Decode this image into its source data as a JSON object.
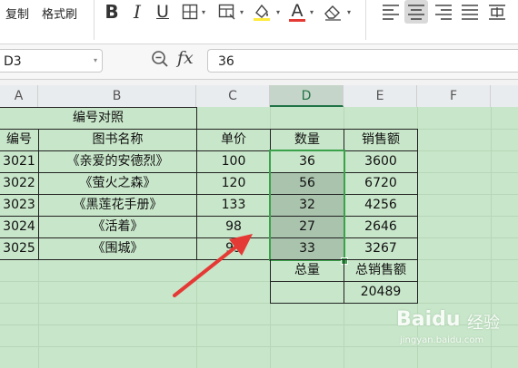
{
  "ribbon": {
    "copy_label": "复制",
    "format_painter_label": "格式刷",
    "bold_label": "B",
    "italic_label": "I",
    "underline_label": "U",
    "font_color_label": "A"
  },
  "formula_bar": {
    "name_box_value": "D3",
    "fx_label": "fx",
    "formula_value": "36"
  },
  "column_headers": [
    "A",
    "B",
    "C",
    "D",
    "E",
    "F"
  ],
  "sheet": {
    "title": "编号对照",
    "headers": [
      "编号",
      "图书名称",
      "单价",
      "数量",
      "销售额"
    ],
    "rows": [
      [
        "3021",
        "《亲爱的安德烈》",
        "100",
        "36",
        "3600"
      ],
      [
        "3022",
        "《萤火之森》",
        "120",
        "56",
        "6720"
      ],
      [
        "3023",
        "《黑莲花手册》",
        "133",
        "32",
        "4256"
      ],
      [
        "3024",
        "《活着》",
        "98",
        "27",
        "2646"
      ],
      [
        "3025",
        "《围城》",
        "99",
        "33",
        "3267"
      ]
    ],
    "total_qty_label": "总量",
    "total_sales_label": "总销售额",
    "total_qty_value": "",
    "total_sales_value": "20489"
  },
  "watermark": {
    "brand": "Baidu",
    "brand_cn": "经验",
    "url": "jingyan.baidu.com"
  },
  "colors": {
    "sheet_bg": "#c8e6c9",
    "selection_border": "#3aa24a",
    "selection_fill": "#a9c3ad",
    "arrow": "#e53935",
    "active_toolbar_button": "#d9d9d9"
  }
}
